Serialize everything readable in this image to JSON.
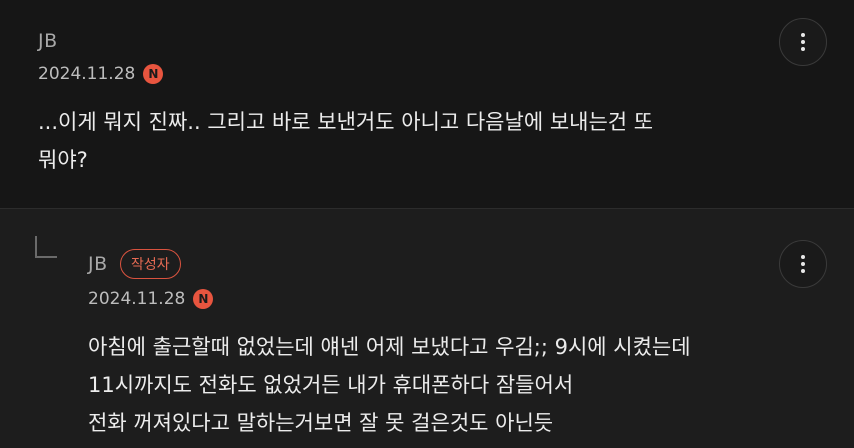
{
  "comment": {
    "author": "JB",
    "date": "2024.11.28",
    "new_badge": "N",
    "text": "...이게 뭐지 진짜.. 그리고 바로 보낸거도 아니고 다음날에 보내는건 또\n뭐야?"
  },
  "reply": {
    "author": "JB",
    "author_badge": "작성자",
    "date": "2024.11.28",
    "new_badge": "N",
    "text": "아침에 출근할때 없었는데 얘넨 어제 보냈다고 우김;; 9시에 시켰는데\n11시까지도 전화도 없었거든 내가 휴대폰하다 잠들어서\n전화 꺼져있다고 말하는거보면 잘 못 걸은것도 아닌듯"
  },
  "icons": {
    "more": "more-vertical-icon",
    "reply": "reply-arrow-icon",
    "new": "new-badge-icon"
  },
  "colors": {
    "background": "#1b1b1b",
    "badge_red": "#e8553f",
    "author_badge_border": "#d9533f"
  }
}
